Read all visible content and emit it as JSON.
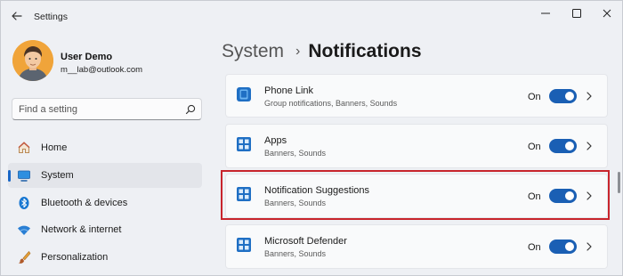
{
  "window": {
    "title": "Settings"
  },
  "user": {
    "name": "User Demo",
    "email": "m__lab@outlook.com"
  },
  "search": {
    "placeholder": "Find a setting",
    "icon": "search-icon"
  },
  "nav": {
    "items": [
      {
        "label": "Home",
        "icon": "home-icon",
        "selected": false
      },
      {
        "label": "System",
        "icon": "system-icon",
        "selected": true
      },
      {
        "label": "Bluetooth & devices",
        "icon": "bluetooth-icon",
        "selected": false
      },
      {
        "label": "Network & internet",
        "icon": "wifi-icon",
        "selected": false
      },
      {
        "label": "Personalization",
        "icon": "brush-icon",
        "selected": false
      }
    ]
  },
  "header": {
    "parent": "System",
    "separator": "›",
    "current": "Notifications"
  },
  "notifications": {
    "items": [
      {
        "title": "Phone Link",
        "subtitle": "Group notifications, Banners, Sounds",
        "state": "On",
        "icon": "phone-link-icon",
        "highlighted": false
      },
      {
        "title": "Apps",
        "subtitle": "Banners, Sounds",
        "state": "On",
        "icon": "apps-icon",
        "highlighted": false
      },
      {
        "title": "Notification Suggestions",
        "subtitle": "Banners, Sounds",
        "state": "On",
        "icon": "apps-icon",
        "highlighted": true
      },
      {
        "title": "Microsoft Defender",
        "subtitle": "Banners, Sounds",
        "state": "On",
        "icon": "apps-icon",
        "highlighted": false
      }
    ]
  },
  "colors": {
    "accent": "#1a5fb4",
    "highlight_border": "#c8242c",
    "avatar": "#f0a43a"
  }
}
